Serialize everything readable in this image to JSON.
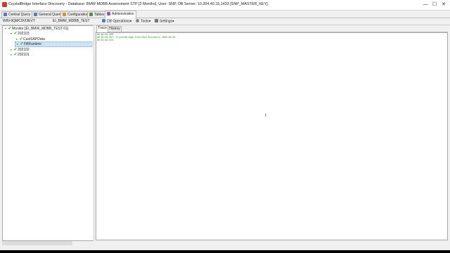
{
  "window": {
    "title": "CrystalBridge Interface Discovery - Database: BMW MDBB Assessment STP [2 Months], User: SNP, DB Server: 10.204.40.15,1433 [SNP_MASTER_KEY]",
    "minimize_glyph": "—",
    "maximize_glyph": "☐",
    "close_glyph": "✕"
  },
  "tabs": [
    {
      "label": "Central Query",
      "icon": "query-icon",
      "color": "#4a7fc1"
    },
    {
      "label": "General Query",
      "icon": "query-icon",
      "color": "#4a7fc1"
    },
    {
      "label": "Configuration",
      "icon": "config-icon",
      "color": "#c59a2b"
    },
    {
      "label": "Tables",
      "icon": "table-icon",
      "color": "#5a8f3a"
    },
    {
      "label": "Administration",
      "icon": "admin-icon",
      "color": "#8a5bb5",
      "active": true
    }
  ],
  "infobar": {
    "server": "WIN-9QMC9VI3EVT",
    "database": "EI_BMW_MDBB_TEST",
    "menus": [
      {
        "label": "DB Operations",
        "icon": "db-icon"
      },
      {
        "label": "Tools",
        "icon": "gear-icon"
      },
      {
        "label": "Settings",
        "icon": "wrench-icon"
      }
    ],
    "dropdown_glyph": "▾"
  },
  "tree": {
    "root": {
      "label": "Monitor [EI_BMW_MDBB_TEST 01]",
      "expanded": true
    },
    "months": [
      {
        "label": "202103",
        "expanded": true,
        "children": [
          {
            "label": "CustSAPData"
          },
          {
            "label": "FillRuntime",
            "selected": true
          }
        ]
      },
      {
        "label": "202102",
        "expanded": false
      },
      {
        "label": "202101",
        "expanded": false
      }
    ],
    "check_glyph": "✔",
    "expanded_glyph": "▾",
    "collapsed_glyph": "▸"
  },
  "subtabs": [
    {
      "label": "Trace",
      "active": true
    },
    {
      "label": "History",
      "active": false
    }
  ],
  "trace_lines": [
    "00:02:04.569:",
    "00:02:04.607: CrystalBridge Interface Discovery 2003-00-00",
    "00:02:04.615:"
  ],
  "colors": {
    "trace_text": "#2a8a1a",
    "selection": "#cde4f7",
    "check": "#3a9a1a"
  }
}
